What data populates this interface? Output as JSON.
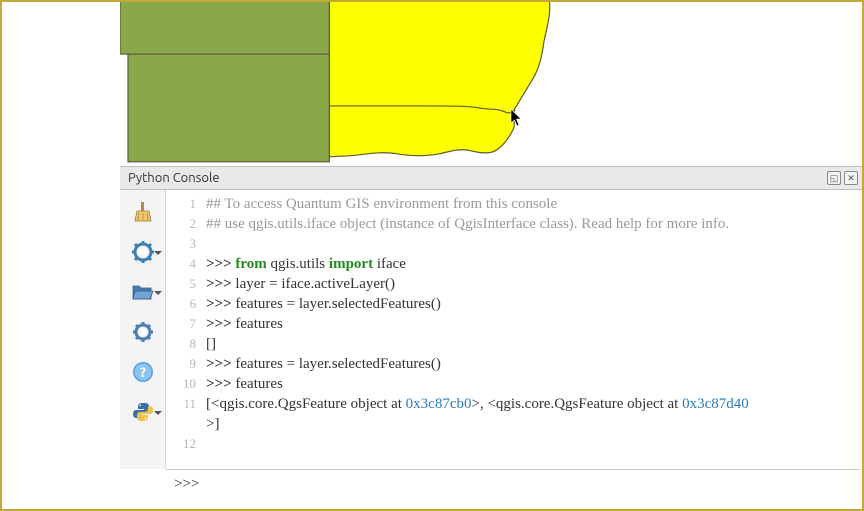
{
  "panel": {
    "title": "Python Console"
  },
  "map": {
    "selected_fill": "#ffff00",
    "unselected_fill": "#8aa84a",
    "stroke": "#5b5b3a"
  },
  "toolbar": {
    "icons": [
      "clear",
      "run",
      "open",
      "settings",
      "help",
      "python"
    ]
  },
  "code": {
    "lines": [
      {
        "n": "1",
        "kind": "comment",
        "text": "## To access Quantum GIS environment from this console"
      },
      {
        "n": "2",
        "kind": "comment",
        "text": "## use qgis.utils.iface object (instance of QgisInterface class). Read help for more info."
      },
      {
        "n": "3",
        "kind": "blank",
        "text": ""
      },
      {
        "n": "4",
        "kind": "import",
        "prompt": ">>> ",
        "kw1": "from",
        "mid": " qgis.utils ",
        "kw2": "import",
        "tail": " iface"
      },
      {
        "n": "5",
        "kind": "stmt",
        "prompt": ">>> ",
        "text": "layer = iface.activeLayer()"
      },
      {
        "n": "6",
        "kind": "stmt",
        "prompt": ">>> ",
        "text": "features = layer.selectedFeatures()"
      },
      {
        "n": "7",
        "kind": "stmt",
        "prompt": ">>> ",
        "text": "features"
      },
      {
        "n": "8",
        "kind": "out",
        "text": "[]"
      },
      {
        "n": "9",
        "kind": "stmt",
        "prompt": ">>> ",
        "text": "features = layer.selectedFeatures()"
      },
      {
        "n": "10",
        "kind": "stmt",
        "prompt": ">>> ",
        "text": "features"
      },
      {
        "n": "11",
        "kind": "out2",
        "pre": "[<qgis.core.QgsFeature object at ",
        "hex1": "0x3c87cb0",
        "mid": ">, <qgis.core.QgsFeature object at ",
        "hex2": "0x3c87d40",
        "tail1": "",
        "tail2": ">]"
      },
      {
        "n": "12",
        "kind": "blank",
        "text": ""
      }
    ]
  },
  "input": {
    "prompt": ">>>",
    "value": ""
  }
}
